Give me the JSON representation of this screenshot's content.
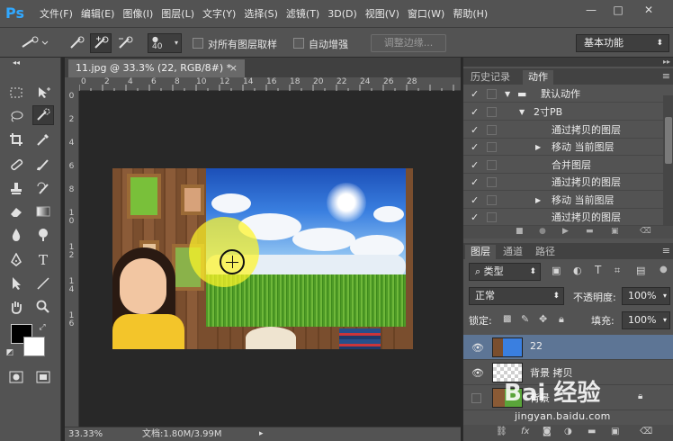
{
  "menubar": {
    "app_logo": "Ps",
    "items": [
      "文件(F)",
      "编辑(E)",
      "图像(I)",
      "图层(L)",
      "文字(Y)",
      "选择(S)",
      "滤镜(T)",
      "3D(D)",
      "视图(V)",
      "窗口(W)",
      "帮助(H)"
    ],
    "window_controls": {
      "minimize": "—",
      "restore": "□",
      "close": "✕"
    }
  },
  "options": {
    "brush_size": "40",
    "sample_all_layers": "对所有图层取样",
    "auto_enhance": "自动增强",
    "refine_edge": "调整边缘...",
    "workspace": "基本功能"
  },
  "document": {
    "tab_title": "11.jpg @ 33.3% (22, RGB/8#) *",
    "close": "×",
    "zoom": "33.33%",
    "doc_info": "文档:1.80M/3.99M"
  },
  "ruler": {
    "h_labels": [
      "0",
      "2",
      "4",
      "6",
      "8",
      "10",
      "12",
      "14",
      "16",
      "18",
      "20",
      "22",
      "24",
      "26",
      "28"
    ],
    "v_labels": [
      "0",
      "2",
      "4",
      "6",
      "8",
      "1\n0",
      "1\n2",
      "1\n4",
      "1\n6"
    ]
  },
  "actions_panel": {
    "tabs": [
      "历史记录",
      "动作"
    ],
    "rows": [
      {
        "label": "默认动作",
        "indent": 0,
        "type": "set",
        "expanded": true
      },
      {
        "label": "2寸PB",
        "indent": 1,
        "type": "action",
        "expanded": true
      },
      {
        "label": "通过拷贝的图层",
        "indent": 2,
        "type": "step"
      },
      {
        "label": "移动 当前图层",
        "indent": 2,
        "type": "step",
        "has_children": true
      },
      {
        "label": "合并图层",
        "indent": 2,
        "type": "step"
      },
      {
        "label": "通过拷贝的图层",
        "indent": 2,
        "type": "step"
      },
      {
        "label": "移动 当前图层",
        "indent": 2,
        "type": "step",
        "has_children": true
      },
      {
        "label": "通过拷贝的图层",
        "indent": 2,
        "type": "step"
      }
    ],
    "checkmark": "✓"
  },
  "layers_panel": {
    "tabs": [
      "图层",
      "通道",
      "路径"
    ],
    "filter_kind": "类型",
    "blend_mode": "正常",
    "opacity_label": "不透明度:",
    "opacity_value": "100%",
    "lock_label": "锁定:",
    "fill_label": "填充:",
    "fill_value": "100%",
    "layers": [
      {
        "name": "22",
        "visible": true,
        "selected": true,
        "locked": false
      },
      {
        "name": "背景 拷贝",
        "visible": true,
        "selected": false,
        "locked": false
      },
      {
        "name": "背景",
        "visible": false,
        "selected": false,
        "locked": true
      }
    ],
    "footer_fx": "fx"
  },
  "watermark": {
    "logo": "Bai 经验",
    "url": "jingyan.baidu.com"
  },
  "colors": {
    "ui_gray": "#535353",
    "canvas_bg": "#282828",
    "selection_blue": "#5d7595",
    "highlight_yellow": "#fff528"
  }
}
